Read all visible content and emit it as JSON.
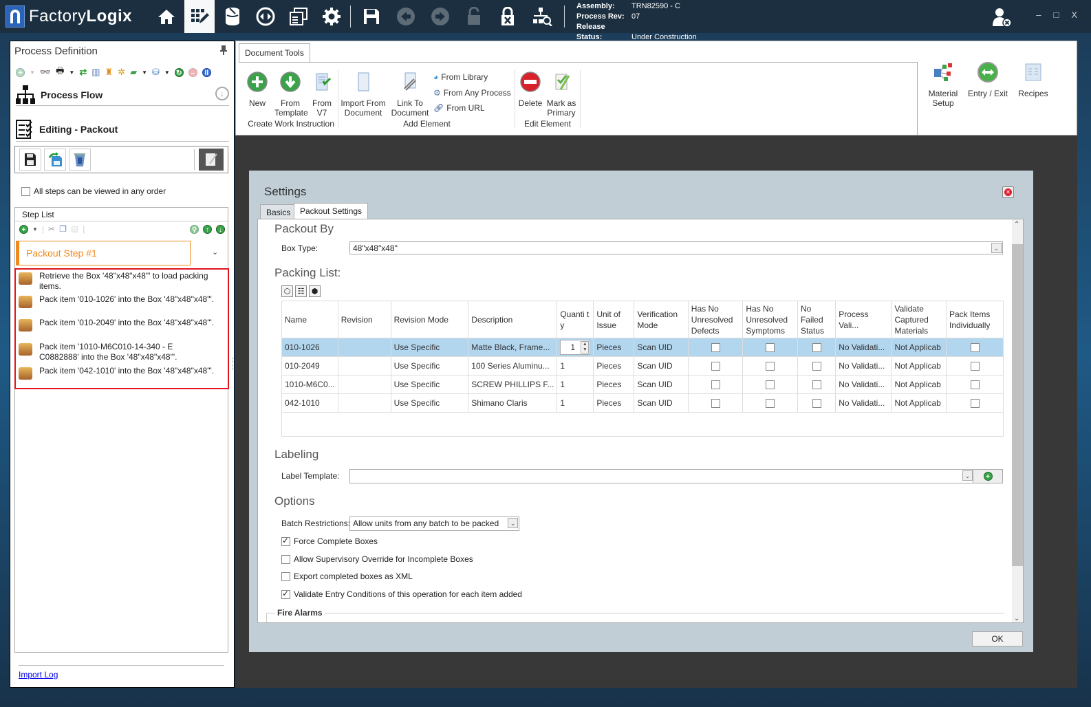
{
  "app": {
    "name_light": "Factory",
    "name_bold": "Logix",
    "nav_icons": [
      {
        "name": "home-icon",
        "glyph": "⌂"
      },
      {
        "name": "process-editor-icon",
        "glyph": "▦",
        "active": true
      },
      {
        "name": "materials-icon",
        "glyph": "⛁"
      },
      {
        "name": "transfer-icon",
        "glyph": "◈"
      },
      {
        "name": "windows-icon",
        "glyph": "❐"
      },
      {
        "name": "settings-gear-icon",
        "glyph": "✹"
      },
      {
        "name": "save-icon",
        "glyph": "💾"
      },
      {
        "name": "back-icon",
        "glyph": "◀",
        "disabled": true
      },
      {
        "name": "forward-icon",
        "glyph": "▶",
        "disabled": true
      },
      {
        "name": "unlock-icon",
        "glyph": "🔓",
        "disabled": true
      },
      {
        "name": "lock-cancel-icon",
        "glyph": "🔒"
      },
      {
        "name": "hierarchy-search-icon",
        "glyph": "⚲"
      }
    ],
    "assembly_label": "Assembly:",
    "assembly_value": "TRN82590 - C",
    "process_rev_label": "Process Rev:",
    "process_rev_value": "07",
    "release_status_label": "Release Status:",
    "release_status_value": "Under Construction",
    "window_controls": {
      "minimize": "–",
      "maximize": "□",
      "close": "X"
    }
  },
  "left_panel": {
    "title": "Process Definition",
    "process_flow_label": "Process Flow",
    "editing_label": "Editing - Packout",
    "all_steps_any_order_label": "All steps can be viewed in any order",
    "all_steps_any_order_checked": false,
    "step_list_header": "Step List",
    "selected_step": "Packout Step #1",
    "steps": [
      {
        "text": "Retrieve the Box '48\"x48\"x48\"' to load packing items."
      },
      {
        "text": "Pack item '010-1026' into the Box '48\"x48\"x48\"'."
      },
      {
        "text": "Pack item '010-2049' into the Box '48\"x48\"x48\"'."
      },
      {
        "text": "Pack item '1010-M6C010-14-340 - E        C0882888' into the Box '48\"x48\"x48\"'."
      },
      {
        "text": "Pack item '042-1010' into the Box '48\"x48\"x48\"'."
      }
    ],
    "import_log_link": "Import Log"
  },
  "ribbon": {
    "tab": "Document Tools",
    "groups": {
      "create_work_instruction": "Create Work Instruction",
      "add_element": "Add Element",
      "edit_element": "Edit Element"
    },
    "buttons": {
      "new": "New",
      "from_template_1": "From",
      "from_template_2": "Template",
      "from_v7_1": "From",
      "from_v7_2": "V7",
      "import_doc_1": "Import From",
      "import_doc_2": "Document",
      "link_doc_1": "Link To",
      "link_doc_2": "Document",
      "from_library": "From Library",
      "from_any_process": "From Any Process",
      "from_url": "From URL",
      "delete": "Delete",
      "mark_primary_1": "Mark as",
      "mark_primary_2": "Primary",
      "material_setup_1": "Material",
      "material_setup_2": "Setup",
      "entry_exit": "Entry / Exit",
      "recipes": "Recipes"
    }
  },
  "settings_dialog": {
    "title": "Settings",
    "tabs": [
      {
        "label": "Basics",
        "active": false
      },
      {
        "label": "Packout Settings",
        "active": true
      }
    ],
    "packout_by": {
      "section": "Packout By",
      "box_type_label": "Box Type:",
      "box_type_value": "48\"x48\"x48\""
    },
    "packing_list": {
      "section": "Packing List:",
      "columns": [
        "Name",
        "Revision",
        "Revision Mode",
        "Description",
        "Quantity",
        "Unit of Issue",
        "Verification Mode",
        "Has No Unresolved Defects",
        "Has No Unresolved Symptoms",
        "No Failed Status",
        "Process Vali...",
        "Validate Captured Materials",
        "Pack Items Individually"
      ],
      "column_display": [
        "Name",
        "Revision",
        "Revision Mode",
        "Description",
        "Quanti ty",
        "Unit of Issue",
        "Verification Mode",
        "Has No Unresolved Defects",
        "Has No Unresolved Symptoms",
        "No Failed Status",
        "Process Vali...",
        "Validate Captured Materials",
        "Pack Items Individually"
      ],
      "rows": [
        {
          "name": "010-1026",
          "revision": "",
          "revision_mode": "Use Specific",
          "description": "Matte Black, Frame...",
          "quantity": "1",
          "unit": "Pieces",
          "verification": "Scan UID",
          "no_defects": false,
          "no_symptoms": false,
          "no_failed": false,
          "process_validation": "No Validati...",
          "validate_captured": "Not Applicab",
          "pack_individually": false,
          "selected": true
        },
        {
          "name": "010-2049",
          "revision": "",
          "revision_mode": "Use Specific",
          "description": "100 Series Aluminu...",
          "quantity": "1",
          "unit": "Pieces",
          "verification": "Scan UID",
          "no_defects": false,
          "no_symptoms": false,
          "no_failed": false,
          "process_validation": "No Validati...",
          "validate_captured": "Not Applicab",
          "pack_individually": false
        },
        {
          "name": "1010-M6C0...",
          "revision": "",
          "revision_mode": "Use Specific",
          "description": "SCREW PHILLIPS F...",
          "quantity": "1",
          "unit": "Pieces",
          "verification": "Scan UID",
          "no_defects": false,
          "no_symptoms": false,
          "no_failed": false,
          "process_validation": "No Validati...",
          "validate_captured": "Not Applicab",
          "pack_individually": false
        },
        {
          "name": "042-1010",
          "revision": "",
          "revision_mode": "Use Specific",
          "description": "Shimano Claris",
          "quantity": "1",
          "unit": "Pieces",
          "verification": "Scan UID",
          "no_defects": false,
          "no_symptoms": false,
          "no_failed": false,
          "process_validation": "No Validati...",
          "validate_captured": "Not Applicab",
          "pack_individually": false
        }
      ]
    },
    "labeling": {
      "section": "Labeling",
      "label_template_label": "Label Template:",
      "label_template_value": ""
    },
    "options": {
      "section": "Options",
      "batch_restrictions_label": "Batch Restrictions:",
      "batch_restrictions_value": "Allow units from any batch to be packed",
      "checkboxes": [
        {
          "label": "Force Complete Boxes",
          "checked": true
        },
        {
          "label": "Allow Supervisory Override for Incomplete Boxes",
          "checked": false
        },
        {
          "label": "Export completed boxes as XML",
          "checked": false
        },
        {
          "label": "Validate Entry Conditions of this operation for each item added",
          "checked": true
        }
      ]
    },
    "fire_alarms_label": "Fire Alarms",
    "ok_label": "OK"
  }
}
